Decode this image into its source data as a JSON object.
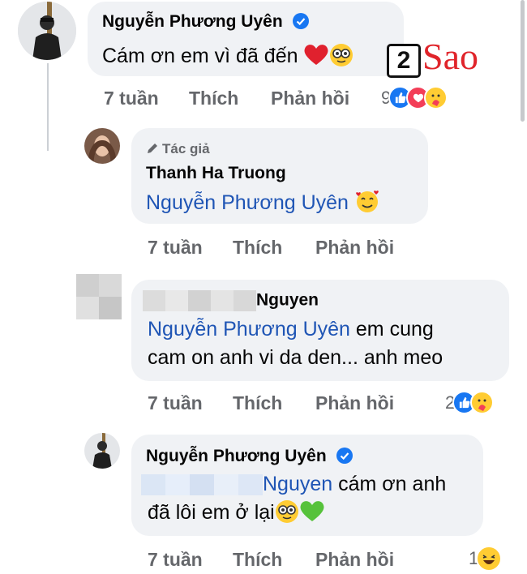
{
  "comments": [
    {
      "author": "Nguyễn Phương Uyên",
      "text": "Cám ơn em vì đã đến",
      "time": "7 tuần",
      "like": "Thích",
      "reply": "Phản hồi",
      "reaction_count": "9",
      "reactions": [
        "like-reaction",
        "love-reaction",
        "care-reaction"
      ]
    },
    {
      "badge": "Tác giả",
      "author": "Thanh Ha Truong",
      "mention": "Nguyễn Phương Uyên",
      "time": "7 tuần",
      "like": "Thích",
      "reply": "Phản hồi"
    },
    {
      "author": "Nguyen",
      "mention": "Nguyễn Phương Uyên",
      "text_line1": " em cung",
      "text_line2": "cam on anh vi da den... anh meo",
      "time": "7 tuần",
      "like": "Thích",
      "reply": "Phản hồi",
      "reaction_count": "2",
      "reactions": [
        "like-reaction",
        "care-reaction"
      ]
    },
    {
      "author": "Nguyễn Phương Uyên",
      "mention": "Nguyen",
      "text_line1": " cám ơn anh",
      "text_line2": "đã lôi em ở lại",
      "time": "7 tuần",
      "like": "Thích",
      "reply": "Phản hồi",
      "reaction_count": "1",
      "reactions": [
        "haha-reaction"
      ]
    }
  ],
  "watermark": {
    "number": "2",
    "text": "Sao"
  },
  "colors": {
    "bubble": "#f0f2f5",
    "mention": "#1f55b5",
    "meta": "#65676b",
    "like": "#1877f2",
    "love": "#f33e58",
    "verified": "#1877f2",
    "watermark": "#e0242a"
  }
}
